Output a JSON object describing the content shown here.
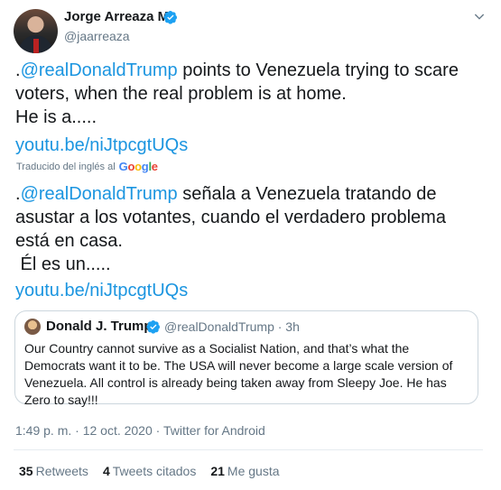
{
  "author": {
    "name": "Jorge Arreaza M",
    "handle": "@jaarreaza"
  },
  "tweet": {
    "original_lines": [
      {
        "prefix": ".",
        "mention": "@realDonaldTrump",
        "rest": " points to Venezuela trying to scare"
      },
      {
        "text": "voters, when the real problem is at home."
      },
      {
        "text": "He is a....."
      }
    ],
    "original_link": "youtu.be/niJtpcgtUQs",
    "translated_label": "Traducido del inglés al",
    "translator_logo_letters": [
      "G",
      "o",
      "o",
      "g",
      "l",
      "e"
    ],
    "translated_lines": [
      {
        "prefix": ".",
        "mention": "@realDonaldTrump",
        "rest": " señala a Venezuela tratando de"
      },
      {
        "text": "asustar a los votantes, cuando el verdadero problema"
      },
      {
        "text": "está en casa."
      },
      {
        "text": " Él es un....."
      }
    ],
    "translated_link": "youtu.be/niJtpcgtUQs"
  },
  "quoted_tweet": {
    "name": "Donald J. Trump",
    "handle_time": "@realDonaldTrump · 3h",
    "text": "Our Country cannot survive as a Socialist Nation, and that’s what the Democrats want it to be. The USA will never become a large scale version of Venezuela. All control is already being taken away from Sleepy Joe. He has Zero to say!!!"
  },
  "meta": {
    "timestamp_source": "1:49 p. m. · 12 oct. 2020 · Twitter for Android"
  },
  "stats": [
    {
      "count": "35",
      "label": "Retweets"
    },
    {
      "count": "4",
      "label": "Tweets citados"
    },
    {
      "count": "21",
      "label": "Me gusta"
    }
  ],
  "colors": {
    "link": "#1b95e0",
    "secondary": "#657786",
    "verified": "#1da1f2"
  }
}
